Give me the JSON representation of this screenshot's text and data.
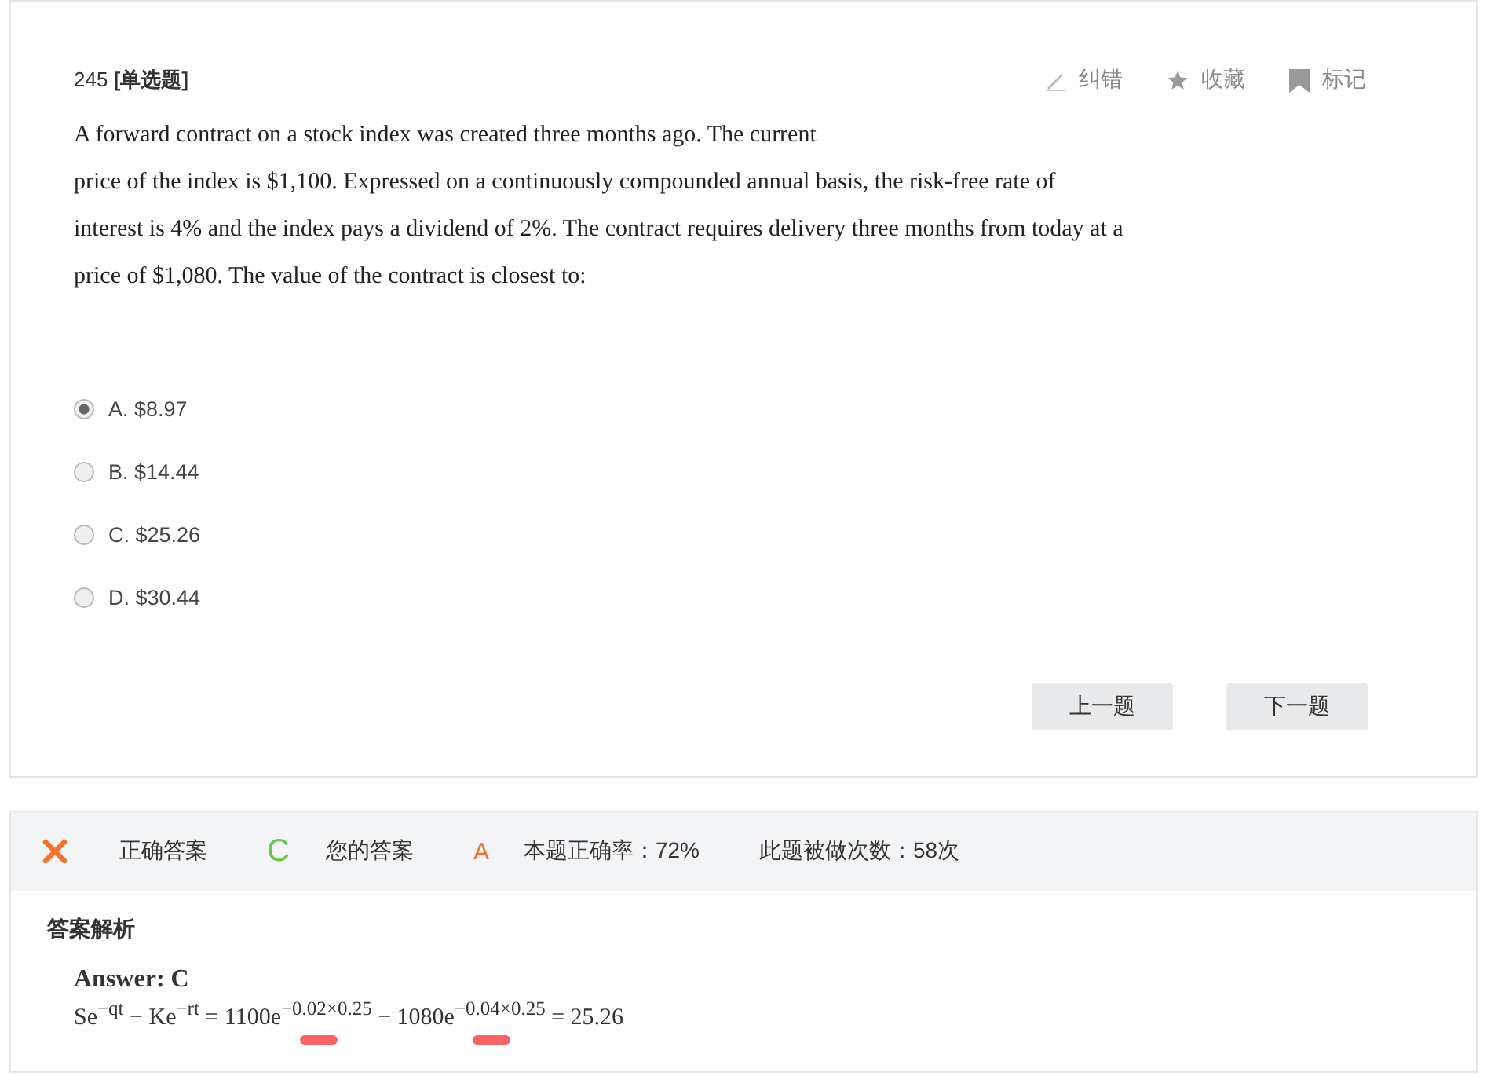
{
  "question": {
    "number": "245",
    "type": "[单选题]",
    "actions": [
      {
        "kind": "pencil",
        "label": "纠错"
      },
      {
        "kind": "star",
        "label": "收藏"
      },
      {
        "kind": "flag",
        "label": "标记"
      }
    ],
    "text_lines": [
      "A forward contract on a stock index was created three months ago. The current",
      "price of the index is $1,100. Expressed on a continuously compounded annual basis, the risk-free rate of",
      "interest is 4% and the index pays a dividend of 2%. The contract requires delivery three months from today at a",
      "price of $1,080. The value of the contract is closest to:"
    ],
    "options": [
      {
        "label": "A. $8.97",
        "selected": true
      },
      {
        "label": "B. $14.44",
        "selected": false
      },
      {
        "label": "C. $25.26",
        "selected": false
      },
      {
        "label": "D. $30.44",
        "selected": false
      }
    ],
    "buttons": [
      "上一题",
      "下一题"
    ]
  },
  "result": {
    "correct": false,
    "correct_label": "正确答案",
    "correct_answer": "C",
    "your_label": "您的答案",
    "your_answer": "A",
    "accuracy": "本题正确率：72%",
    "attempts": "此题被做次数：58次"
  },
  "analysis": {
    "title": "答案解析",
    "answer": "Answer: C",
    "formula": "Se$^{−qt}$ − Ke$^{−rt}$ = 1100e$^{−0.02×0.25}$ − 1080e$^{−0.04×0.25}$ = 25.26"
  }
}
